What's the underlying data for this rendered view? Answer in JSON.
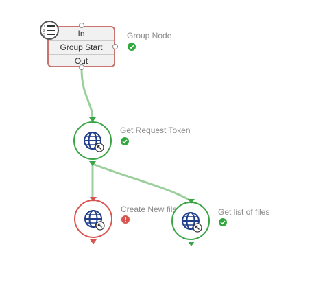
{
  "group_node": {
    "title": "Group Node",
    "rows": [
      "In",
      "Group Start",
      "Out"
    ],
    "icon": "numbered-list-icon",
    "status": "ok"
  },
  "nodes": [
    {
      "id": "get-request-token",
      "title": "Get Request Token",
      "icon": "globe-pointer-icon",
      "status": "ok"
    },
    {
      "id": "create-new-file",
      "title": "Create New file",
      "icon": "globe-pointer-icon",
      "status": "error"
    },
    {
      "id": "get-list-of-files",
      "title": "Get list of files",
      "icon": "globe-pointer-icon",
      "status": "ok"
    }
  ],
  "colors": {
    "ok": "#3aa447",
    "error": "#d9534f",
    "connector": "#9ccf9b",
    "group_border": "#c8746e",
    "label": "#8a8a8a"
  }
}
